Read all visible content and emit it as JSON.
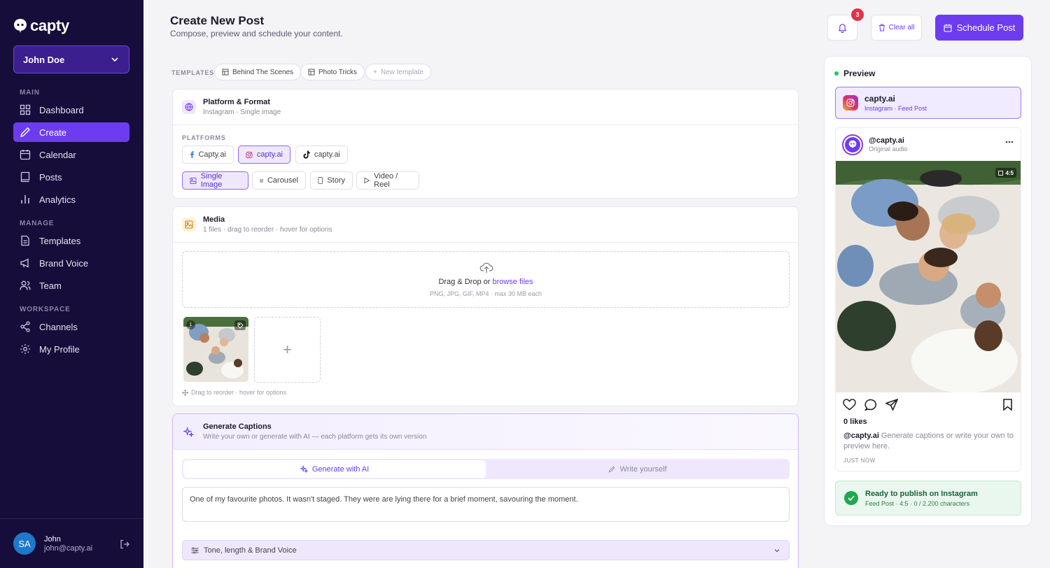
{
  "sidebar": {
    "logo_text": "capty",
    "user_select": "John Doe",
    "sections": {
      "main": "MAIN",
      "manage": "MANAGE",
      "workspace": "WORKSPACE"
    },
    "items": [
      {
        "label": "Dashboard",
        "icon": "grid-icon"
      },
      {
        "label": "Create",
        "icon": "pencil-icon"
      },
      {
        "label": "Calendar",
        "icon": "calendar-icon"
      },
      {
        "label": "Posts",
        "icon": "book-icon"
      },
      {
        "label": "Analytics",
        "icon": "bar-chart-icon"
      },
      {
        "label": "Templates",
        "icon": "file-icon"
      },
      {
        "label": "Brand Voice",
        "icon": "megaphone-icon"
      },
      {
        "label": "Team",
        "icon": "users-icon"
      },
      {
        "label": "Channels",
        "icon": "share-icon"
      },
      {
        "label": "My Profile",
        "icon": "gear-icon"
      }
    ],
    "footer": {
      "initials": "SA",
      "name": "John",
      "email": "john@capty.ai"
    }
  },
  "header": {
    "title": "Create New Post",
    "subtitle": "Compose, preview and schedule your content.",
    "notification_count": "3",
    "clear_label": "Clear all",
    "schedule_label": "Schedule Post"
  },
  "templates": {
    "label": "TEMPLATES",
    "items": [
      "Behind The Scenes",
      "Photo Tricks"
    ],
    "new_label": "New template"
  },
  "platform_card": {
    "title": "Platform & Format",
    "subtitle": "Instagram · Single image",
    "platforms_label": "PLATFORMS",
    "platforms": [
      "Capty.ai",
      "capty.ai",
      "capty.ai"
    ],
    "formats": [
      "Single Image",
      "Carousel",
      "Story",
      "Video / Reel"
    ]
  },
  "media_card": {
    "title": "Media",
    "subtitle": "1 files · drag to reorder · hover for options",
    "drop_text": "Drag & Drop or ",
    "browse_text": "browse files",
    "drop_sub": "PNG, JPG, GIF, MP4 · max 30 MB each",
    "thumb_number": "1",
    "add_symbol": "+",
    "hint": "Drag to reorder · hover for options"
  },
  "caption_card": {
    "title": "Generate Captions",
    "subtitle": "Write your own or generate with AI — each platform gets its own version",
    "tab_ai": "Generate with AI",
    "tab_write": "Write yourself",
    "caption_value": "One of my favourite photos. It wasn't staged. They were are lying there for a brief moment, savouring the moment.",
    "tone_label": "Tone, length & Brand Voice"
  },
  "preview": {
    "title": "Preview",
    "account_name": "capty.ai",
    "account_sub": "Instagram · Feed Post",
    "handle": "@capty.ai",
    "audio": "Original audio",
    "ratio": "4:5",
    "likes": "0 likes",
    "caption_handle": "@capty.ai",
    "caption_placeholder": " Generate captions or write your own to preview here.",
    "time": "JUST NOW",
    "ready_title": "Ready to publish on Instagram",
    "ready_sub": "Feed Post · 4:5 · 0 / 2.200 characters"
  },
  "colors": {
    "accent": "#6d3cf0",
    "sidebar_bg": "#160d3a",
    "success": "#1fa84f",
    "badge": "#e0344a"
  }
}
